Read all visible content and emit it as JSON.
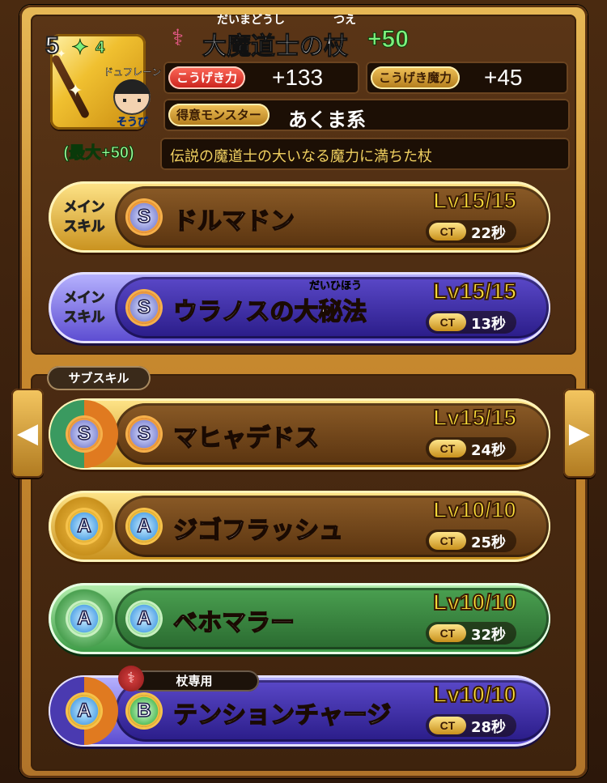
{
  "weapon": {
    "rank": "5",
    "plus_level": "4",
    "title": "大魔道士の杖",
    "title_ruby_1": "だいまどうし",
    "title_ruby_2": "つえ",
    "bonus": "+50",
    "max_bonus": "(最大+50)",
    "equipped_by": "ドュフレーン",
    "equip_label": "そうび",
    "stats": [
      {
        "label": "こうげき力",
        "value": "+133"
      },
      {
        "label": "こうげき魔力",
        "value": "+45"
      }
    ],
    "specialty_label": "得意モンスター",
    "specialty_value": "あくま系",
    "description": "伝説の魔道士の大いなる魔力に満ちた杖"
  },
  "main_skill_label": "メイン\nスキル",
  "main_skill_label_line1": "メイン",
  "main_skill_label_line2": "スキル",
  "sub_skill_label": "サブスキル",
  "exclusive_label": "杖専用",
  "ct_icon_text": "CT",
  "main_skills": [
    {
      "rank": "S",
      "name": "ドルマドン",
      "ruby": "",
      "level": "Lv15/15",
      "ct": "22秒",
      "color": "gold"
    },
    {
      "rank": "S",
      "name": "ウラノスの大秘法",
      "ruby": "だいひほう",
      "level": "Lv15/15",
      "ct": "13秒",
      "color": "purple"
    }
  ],
  "sub_skills": [
    {
      "medal_rank": "S",
      "rank": "S",
      "name": "マヒャデドス",
      "level": "Lv15/15",
      "ct": "24秒",
      "color": "gold"
    },
    {
      "medal_rank": "A",
      "rank": "A",
      "name": "ジゴフラッシュ",
      "level": "Lv10/10",
      "ct": "25秒",
      "color": "gold"
    },
    {
      "medal_rank": "A",
      "rank": "A",
      "name": "ベホマラー",
      "level": "Lv10/10",
      "ct": "32秒",
      "color": "green"
    },
    {
      "medal_rank": "A",
      "rank": "B",
      "name": "テンションチャージ",
      "level": "Lv10/10",
      "ct": "28秒",
      "color": "purple"
    }
  ],
  "colors": {
    "frame": "#c98a2e",
    "gold_skill": "#c8901c",
    "purple_skill": "#5a4ad0",
    "green_skill": "#3a9a44",
    "level_text": "#ffe23a",
    "bonus_text": "#7cf07c"
  },
  "icons": {
    "prev": "chevron-left-icon",
    "next": "chevron-right-icon",
    "title": "staff-icon",
    "exclusive": "staff-exclusive-icon"
  }
}
